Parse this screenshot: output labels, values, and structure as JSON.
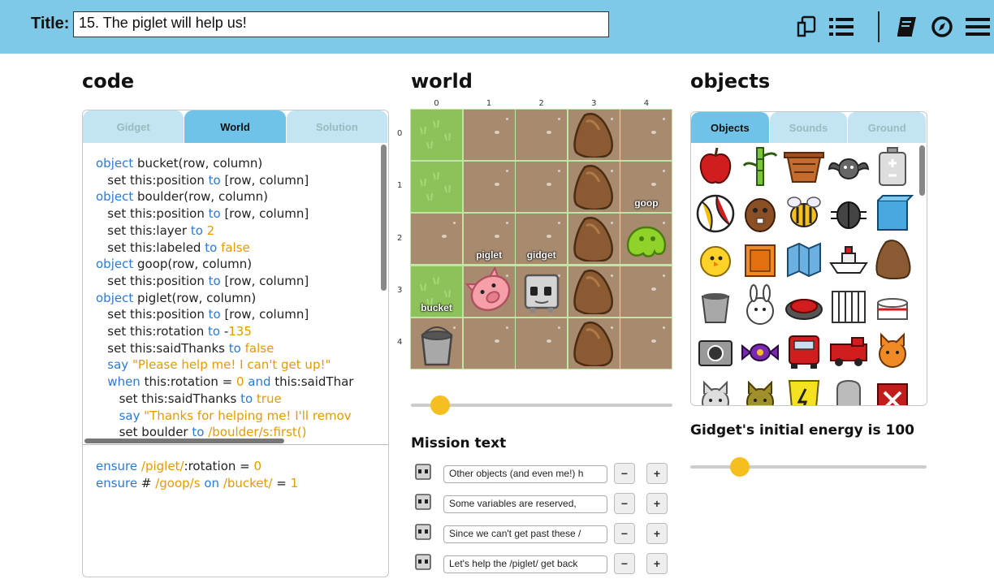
{
  "header": {
    "title_label": "Title:",
    "title_value": "15. The piglet will help us!",
    "icons": [
      "copy-icon",
      "list-icon",
      "book-icon",
      "compass-icon",
      "menu-icon"
    ]
  },
  "sections": {
    "code": "code",
    "world": "world",
    "objects": "objects"
  },
  "code_tabs": [
    {
      "label": "Gidget",
      "active": false
    },
    {
      "label": "World",
      "active": true
    },
    {
      "label": "Solution",
      "active": false
    }
  ],
  "code_lines": [
    [
      {
        "t": "object",
        "c": "kw"
      },
      {
        "t": " bucket(row, column)"
      }
    ],
    [
      {
        "t": "   set this:position "
      },
      {
        "t": "to",
        "c": "kw"
      },
      {
        "t": " [row, column]"
      }
    ],
    [
      {
        "t": "object",
        "c": "kw"
      },
      {
        "t": " boulder(row, column)"
      }
    ],
    [
      {
        "t": "   set this:position "
      },
      {
        "t": "to",
        "c": "kw"
      },
      {
        "t": " [row, column]"
      }
    ],
    [
      {
        "t": "   set this:layer "
      },
      {
        "t": "to",
        "c": "kw"
      },
      {
        "t": " "
      },
      {
        "t": "2",
        "c": "str"
      }
    ],
    [
      {
        "t": "   set this:labeled "
      },
      {
        "t": "to",
        "c": "kw"
      },
      {
        "t": " "
      },
      {
        "t": "false",
        "c": "str"
      }
    ],
    [
      {
        "t": "object",
        "c": "kw"
      },
      {
        "t": " goop(row, column)"
      }
    ],
    [
      {
        "t": "   set this:position "
      },
      {
        "t": "to",
        "c": "kw"
      },
      {
        "t": " [row, column]"
      }
    ],
    [
      {
        "t": "object",
        "c": "kw"
      },
      {
        "t": " piglet(row, column)"
      }
    ],
    [
      {
        "t": "   set this:position "
      },
      {
        "t": "to",
        "c": "kw"
      },
      {
        "t": " [row, column]"
      }
    ],
    [
      {
        "t": "   set this:rotation "
      },
      {
        "t": "to",
        "c": "kw"
      },
      {
        "t": " -"
      },
      {
        "t": "135",
        "c": "str"
      }
    ],
    [
      {
        "t": "   set this:saidThanks "
      },
      {
        "t": "to",
        "c": "kw"
      },
      {
        "t": " "
      },
      {
        "t": "false",
        "c": "str"
      }
    ],
    [
      {
        "t": "   say ",
        "c": "kw"
      },
      {
        "t": "\"Please help me! I can't get up!\"",
        "c": "str"
      }
    ],
    [
      {
        "t": "   when",
        "c": "kw"
      },
      {
        "t": " this:rotation = "
      },
      {
        "t": "0",
        "c": "str"
      },
      {
        "t": " "
      },
      {
        "t": "and",
        "c": "kw"
      },
      {
        "t": " this:saidThar"
      }
    ],
    [
      {
        "t": "      set this:saidThanks "
      },
      {
        "t": "to",
        "c": "kw"
      },
      {
        "t": " "
      },
      {
        "t": "true",
        "c": "str"
      }
    ],
    [
      {
        "t": "      say ",
        "c": "kw"
      },
      {
        "t": "\"Thanks for helping me! I'll remov",
        "c": "str"
      }
    ],
    [
      {
        "t": "      set boulder "
      },
      {
        "t": "to",
        "c": "kw"
      },
      {
        "t": " /boulder/s:first()",
        "c": "str"
      }
    ]
  ],
  "goal_lines": [
    [
      {
        "t": "ensure",
        "c": "kw"
      },
      {
        "t": " "
      },
      {
        "t": "/piglet/",
        "c": "str"
      },
      {
        "t": ":rotation = "
      },
      {
        "t": "0",
        "c": "str"
      }
    ],
    [
      {
        "t": "ensure",
        "c": "kw"
      },
      {
        "t": " # "
      },
      {
        "t": "/goop/s",
        "c": "str"
      },
      {
        "t": " "
      },
      {
        "t": "on",
        "c": "kw"
      },
      {
        "t": " "
      },
      {
        "t": "/bucket/",
        "c": "str"
      },
      {
        "t": " = "
      },
      {
        "t": "1",
        "c": "str"
      }
    ]
  ],
  "world": {
    "col_numbers": [
      "0",
      "1",
      "2",
      "3",
      "4"
    ],
    "row_numbers": [
      "0",
      "1",
      "2",
      "3",
      "4"
    ],
    "cells": [
      [
        "grass",
        "dirt",
        "dirt",
        "dirt",
        "dirt"
      ],
      [
        "grass",
        "dirt",
        "dirt",
        "dirt",
        "dirt"
      ],
      [
        "dirt",
        "dirt",
        "dirt",
        "dirt",
        "dirt"
      ],
      [
        "grass",
        "dirt",
        "dirt",
        "dirt",
        "dirt"
      ],
      [
        "dirt",
        "dirt",
        "dirt",
        "dirt",
        "dirt"
      ]
    ],
    "objects": [
      {
        "type": "boulder",
        "row": 0,
        "col": 3
      },
      {
        "type": "boulder",
        "row": 1,
        "col": 3
      },
      {
        "type": "boulder",
        "row": 2,
        "col": 3
      },
      {
        "type": "boulder",
        "row": 3,
        "col": 3
      },
      {
        "type": "boulder",
        "row": 4,
        "col": 3
      },
      {
        "type": "goop",
        "row": 2,
        "col": 4
      },
      {
        "type": "piglet",
        "row": 3,
        "col": 1
      },
      {
        "type": "gidget",
        "row": 3,
        "col": 2
      },
      {
        "type": "bucket",
        "row": 4,
        "col": 0
      }
    ],
    "labels": [
      {
        "text": "goop",
        "row": 1,
        "col": 4
      },
      {
        "text": "piglet",
        "row": 2,
        "col": 1
      },
      {
        "text": "gidget",
        "row": 2,
        "col": 2
      },
      {
        "text": "bucket",
        "row": 3,
        "col": 0
      }
    ],
    "time_slider": 0.1
  },
  "mission": {
    "title": "Mission text",
    "rows": [
      {
        "text": "Other objects (and even me!) h"
      },
      {
        "text": " Some variables are reserved,"
      },
      {
        "text": "Since we can't get past these /"
      },
      {
        "text": "Let's help the /piglet/ get back "
      }
    ],
    "minus": "−",
    "plus": "+"
  },
  "object_tabs": [
    {
      "label": "Objects",
      "active": true
    },
    {
      "label": "Sounds",
      "active": false
    },
    {
      "label": "Ground",
      "active": false
    }
  ],
  "object_icons": [
    "apple-icon",
    "bamboo-icon",
    "basket-icon",
    "bat-icon",
    "battery-icon",
    "beachball-icon",
    "beaver-icon",
    "bee-icon",
    "beetle-icon",
    "blue-box-icon",
    "chick-icon",
    "orange-box-icon",
    "map-icon",
    "boat-icon",
    "boulder-icon",
    "bucket-icon",
    "bunny-icon",
    "button-icon",
    "cage-icon",
    "cake-icon",
    "camera-icon",
    "candy-icon",
    "red-car-icon",
    "truck-icon",
    "orange-cat-icon",
    "grey-cat-icon",
    "olive-cat-icon",
    "battery-yellow-icon",
    "tombstone-icon",
    "red-x-box-icon"
  ],
  "energy": {
    "label": "Gidget's initial energy is 100",
    "level": 0.21
  },
  "colors": {
    "header": "#7ec8e8",
    "keyword": "#2a7ad6",
    "string": "#e49a00",
    "tab_active": "#6fc3e8",
    "slider_knob": "#f5c01f"
  }
}
